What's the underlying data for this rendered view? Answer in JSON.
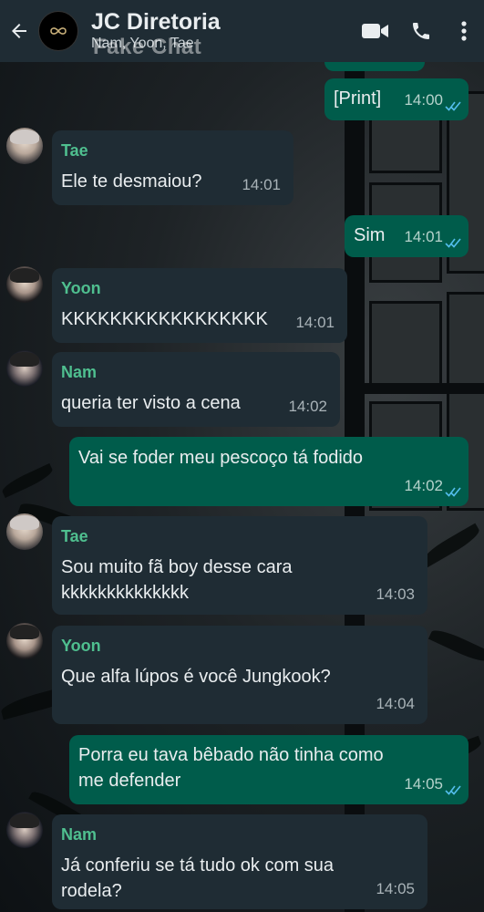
{
  "header": {
    "back_icon": "arrow-left-icon",
    "title": "JC Diretoria",
    "subtitle": "Nam, Yoon, Tae",
    "watermark": "Fake Chat",
    "icons": [
      "video-call-icon",
      "phone-icon",
      "more-vert-icon"
    ]
  },
  "messages": [
    {
      "direction": "out",
      "text": "[Print]",
      "time": "14:00",
      "read": true
    },
    {
      "direction": "in",
      "sender": "Tae",
      "text": "Ele te desmaiou?",
      "time": "14:01"
    },
    {
      "direction": "out",
      "text": "Sim",
      "time": "14:01",
      "read": true
    },
    {
      "direction": "in",
      "sender": "Yoon",
      "text": "KKKKKKKKKKKKKKKKK",
      "time": "14:01"
    },
    {
      "direction": "in",
      "sender": "Nam",
      "text": "queria ter visto a cena",
      "time": "14:02"
    },
    {
      "direction": "out",
      "text": "Vai se foder meu pescoço tá fodido",
      "time": "14:02",
      "read": true
    },
    {
      "direction": "in",
      "sender": "Tae",
      "text_line1": "Sou muito fã boy desse cara",
      "text_line2": "kkkkkkkkkkkkkk",
      "time": "14:03"
    },
    {
      "direction": "in",
      "sender": "Yoon",
      "text": "Que alfa lúpos é você Jungkook?",
      "time": "14:04"
    },
    {
      "direction": "out",
      "text_line1": "Porra eu tava bêbado não tinha como",
      "text_line2": "me defender",
      "time": "14:05",
      "read": true
    },
    {
      "direction": "in",
      "sender": "Nam",
      "text_line1": "Já conferiu se tá tudo ok com sua",
      "text_line2": "rodela?",
      "time": "14:05"
    }
  ],
  "colors": {
    "header_bg": "#1f2c34",
    "incoming_bubble": "#1f2c34",
    "outgoing_bubble": "#005c4b",
    "sender_name": "#4fbf8f",
    "read_ticks": "#53bdeb"
  }
}
